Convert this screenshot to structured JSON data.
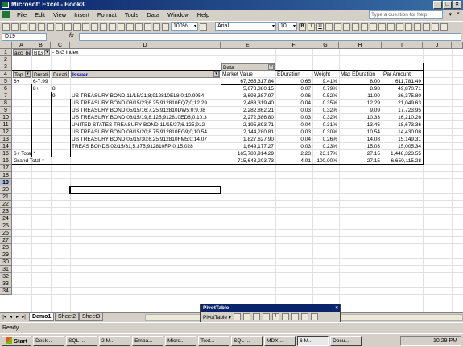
{
  "window": {
    "title": "Microsoft Excel - Book3",
    "controls": [
      "_",
      "□",
      "×"
    ]
  },
  "menu": {
    "items": [
      "File",
      "Edit",
      "View",
      "Insert",
      "Format",
      "Tools",
      "Data",
      "Window",
      "Help"
    ],
    "help_placeholder": "Type a question for help"
  },
  "toolbar": {
    "zoom": "100%",
    "font": "Arial",
    "size": "10"
  },
  "formula_bar": {
    "name_box": "D19",
    "fx": "fx",
    "content": ""
  },
  "columns": [
    "A",
    "B",
    "C",
    "D",
    "E",
    "F",
    "G",
    "H",
    "I",
    "J"
  ],
  "rows": [
    "1",
    "2",
    "3",
    "4",
    "5",
    "6",
    "7",
    "8",
    "9",
    "10",
    "11",
    "12",
    "13",
    "14",
    "15",
    "16",
    "17",
    "18",
    "19",
    "20",
    "21",
    "22",
    "23",
    "24",
    "25",
    "26",
    "27",
    "28",
    "29",
    "30",
    "31",
    "32",
    "33",
    "34"
  ],
  "cells": {
    "a1": "acc_be",
    "b1": "BIG",
    "c1": "- BIG index",
    "e3": "Data",
    "a4": "Top",
    "b4": "Durati",
    "c4": "Durati",
    "d4": "Issuer",
    "e4": "Market Value",
    "f4": "EDuration",
    "g4": "Weight",
    "h4": "Max EDuration",
    "i4": "Par Amount",
    "a5": "6+",
    "b5": "6-7.99",
    "e5": "67,365,317.84",
    "f5": "0.65",
    "g5": "9.41%",
    "h5": "8.00",
    "i5": "611,781.49",
    "b6": "8+",
    "c6": "8",
    "e6": "5,678,380.15",
    "f6": "0.07",
    "g6": "0.79%",
    "h6": "8.98",
    "i6": "49,870.71",
    "c7": "9",
    "d7": "US TREASURY BOND;11/15/21;8;912810EL8;0;10.9954",
    "e7": "3,698,387.97",
    "f7": "0.06",
    "g7": "0.52%",
    "h7": "11.00",
    "i7": "26,375.80",
    "d8": "US TREASURY BOND;08/15/23;6.25;912810EQ7;0;12.29",
    "e8": "2,488,319.40",
    "f8": "0.04",
    "g8": "0.35%",
    "h8": "12.29",
    "i8": "21,049.63",
    "d9": "US TREASURY BOND;05/15/16;7.25;912810DW5;0;9.08",
    "e9": "2,282,862.21",
    "f9": "0.03",
    "g9": "0.32%",
    "h9": "9.09",
    "i9": "17,723.95",
    "d10": "US TREASURY BOND;08/15/19;8.125;912810ED6;0;10.3",
    "e10": "2,272,386.80",
    "f10": "0.03",
    "g10": "0.32%",
    "h10": "10.33",
    "i10": "16,210.26",
    "d11": "UNITED STATES TREASURY BOND;11/15/27;6.125;912",
    "e11": "2,195,893.71",
    "f11": "0.04",
    "g11": "0.31%",
    "h11": "13.45",
    "i11": "18,673.36",
    "d12": "US TREASURY BOND;08/15/20;8.75;912810EG9;0;10.54",
    "e12": "2,144,280.81",
    "f12": "0.03",
    "g12": "0.30%",
    "h12": "10.54",
    "i12": "14,430.08",
    "d13": "US TREASURY BOND;05/15/30;6.25;912810FM5;0;14.07",
    "e13": "1,827,627.90",
    "f13": "0.04",
    "g13": "0.26%",
    "h13": "14.08",
    "i13": "15,149.31",
    "d14": "TREAS BONDS;02/15/31;5.375;912810FP;0;15.028",
    "e14": "1,649,177.27",
    "f14": "0.03",
    "g14": "0.23%",
    "h14": "15.03",
    "i14": "15,005.34",
    "a15": "6+ Total *",
    "e15": "165,780,914.29",
    "f15": "2.23",
    "g15": "23.17%",
    "h15": "27.15",
    "i15": "1,448,323.55",
    "a16": "Grand Total *",
    "e16": "715,643,203.73",
    "f16": "4.01",
    "g16": "100.00%",
    "h16": "27.15",
    "i16": "6,650,115.28"
  },
  "sheets": [
    "Demo1",
    "Sheet2",
    "Sheet3"
  ],
  "status": "Ready",
  "pivot": {
    "title": "PivotTable",
    "menu": "PivotTable ▾"
  },
  "taskbar": {
    "start": "Start",
    "tasks": [
      "Desk...",
      "SQL ...",
      "2 M...",
      "Emba...",
      "Micro...",
      "Text...",
      "SQL ...",
      "MDX ...",
      "6 M...",
      "Docu..."
    ],
    "clock": "10:29 PM"
  }
}
